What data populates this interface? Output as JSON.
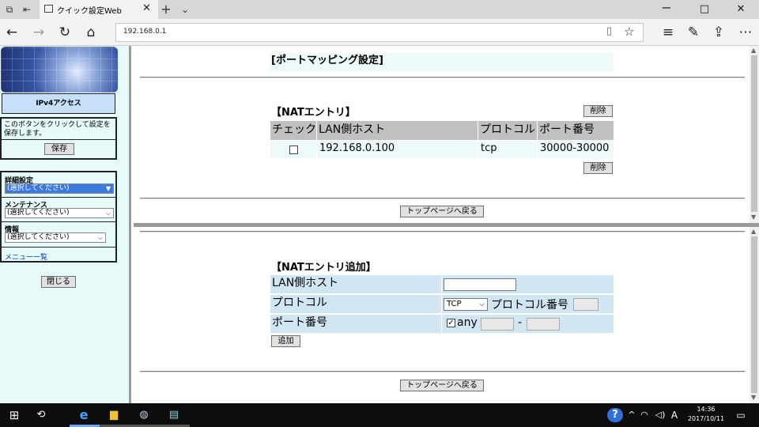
{
  "browser": {
    "tab_title": "クイック設定Web",
    "new_tab_symbol": "+",
    "address": "192.168.0.1",
    "win_minimize": "ー",
    "win_restore": "□",
    "win_close": "✕"
  },
  "left": {
    "ipv4_label": "IPv4アクセス",
    "save_hint": "このボタンをクリックして設定を保存します。",
    "save_button": "保存",
    "detail_label": "詳細設定",
    "detail_value": "(選択してください)",
    "maintenance_label": "メンテナンス",
    "maintenance_value": "(選択してください)",
    "info_label": "情報",
    "info_value": "(選択してください)",
    "menu_list": "メニュー一覧",
    "close_button": "閉じる"
  },
  "top": {
    "page_title": "[ポートマッピング設定]",
    "section_title": "【NATエントリ】",
    "delete_button": "削除",
    "columns": [
      "チェック",
      "LAN側ホスト",
      "プロトコル",
      "ポート番号"
    ],
    "rows": [
      {
        "host": "192.168.0.100",
        "protocol": "tcp",
        "port": "30000-30000"
      }
    ],
    "back_button": "トップページへ戻る"
  },
  "bottom": {
    "section_title": "【NATエントリ追加】",
    "lan_host_label": "LAN側ホスト",
    "lan_host_value": "",
    "protocol_label": "プロトコル",
    "protocol_value": "TCP",
    "protocol_number_label": "プロトコル番号",
    "port_label": "ポート番号",
    "any_label": "any",
    "range_sep": "-",
    "add_button": "追加",
    "back_button": "トップページへ戻る"
  },
  "taskbar": {
    "time": "14:36",
    "date": "2017/10/11",
    "ime": "A"
  },
  "icons": [
    "tab-list-icon",
    "back-tab-icon",
    "page-icon",
    "close-tab-icon",
    "new-tab-icon",
    "tab-menu-icon",
    "back-icon",
    "forward-icon",
    "refresh-icon",
    "home-icon",
    "reading-view-icon",
    "favorite-star-icon",
    "favorites-hub-icon",
    "pen-icon",
    "share-icon",
    "more-icon",
    "windows-start-icon",
    "cortana-icon",
    "edge-icon",
    "file-explorer-icon",
    "app-icon",
    "notepad-icon",
    "help-icon",
    "network-icon",
    "volume-icon",
    "notification-icon"
  ]
}
